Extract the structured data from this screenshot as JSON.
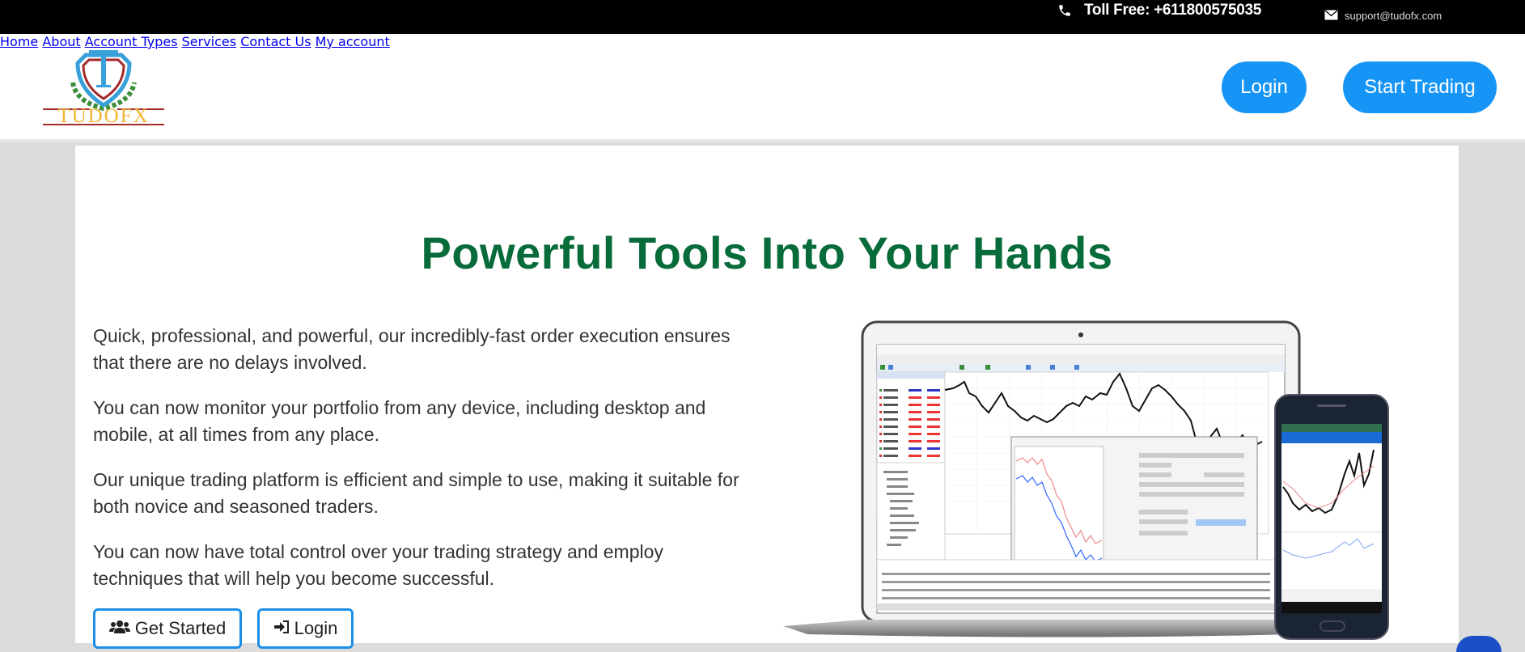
{
  "topbar": {
    "phone_icon": "phone-icon",
    "toll_free": "Toll Free: +611800575035",
    "mail_icon": "envelope-icon",
    "email": "support@tudofx.com"
  },
  "header": {
    "logo_text": "TUDOFX",
    "nav": [
      {
        "label": "Home"
      },
      {
        "label": "About"
      },
      {
        "label": "Account Types"
      },
      {
        "label": "Services"
      },
      {
        "label": "Contact Us"
      },
      {
        "label": "My account"
      }
    ],
    "login_label": "Login",
    "start_trading_label": "Start Trading"
  },
  "main": {
    "title": "Powerful Tools Into Your Hands",
    "paragraphs": [
      "Quick, professional, and powerful, our incredibly-fast order execution ensures that there are no delays involved.",
      "You can now monitor your portfolio from any device, including desktop and mobile, at all times from any place.",
      "Our unique trading platform is efficient and simple to use, making it suitable for both novice and seasoned traders.",
      "You can now have total control over your trading strategy and employ techniques that will help you become successful."
    ],
    "get_started_label": "Get Started",
    "get_started_icon": "users-icon",
    "login_label": "Login",
    "login_icon": "sign-in-icon",
    "image_alt": "Trading platform on laptop and mobile phone"
  },
  "colors": {
    "nav_link": "#f1b42f",
    "button_blue": "#1795f6",
    "title_green": "#086b3a",
    "outline_blue": "#1e8fe6"
  }
}
